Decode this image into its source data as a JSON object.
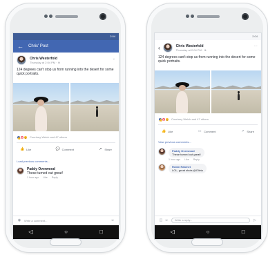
{
  "left_phone": {
    "status_time": "2:04",
    "appbar": {
      "title": "Chris' Post",
      "back_icon": "←"
    },
    "post": {
      "author": "Chris Westerfold",
      "time": "Thursday at 2:04 PM · ⊕",
      "text": "124 degrees can't stop us from running into the desert for some quick portraits.",
      "reactions_text": "Courtney Welch and 47 others",
      "actions": {
        "like": "Like",
        "comment": "Comment",
        "share": "Share"
      },
      "load_previous": "Load previous comments...",
      "comment": {
        "name": "Paddy Overwood",
        "text": "These turned out great!",
        "meta": {
          "time": "1 hour ago",
          "like": "Like",
          "reply": "Reply"
        }
      },
      "composer_placeholder": "Write a comment..."
    }
  },
  "right_phone": {
    "status_time": "2:04",
    "post": {
      "author": "Chris Westerfold",
      "time": "Thursday at 2:04 PM · ⊕",
      "text": "124 degrees can't stop us from running into the desert for some quick portraits.",
      "reactions_text": "Courtney Welch and 47 others",
      "actions": {
        "like": "Like",
        "comment": "Comment",
        "share": "Share"
      },
      "load_previous": "View previous comments...",
      "comments": [
        {
          "name": "Paddy Overwood",
          "text": "These turned out great!",
          "meta": {
            "time": "1 hour ago",
            "like": "Like",
            "reply": "Reply"
          }
        },
        {
          "name": "Robin Ratchet",
          "text": "LOL, great shots @Olivia"
        }
      ],
      "composer_placeholder": "Write a reply..."
    }
  },
  "nav_icons": {
    "back": "◁",
    "home": "○",
    "recent": "□"
  },
  "colors": {
    "facebook_blue": "#4267b2",
    "reaction_like": "#4267b2",
    "reaction_love": "#f25268",
    "reaction_wow": "#f7b928"
  }
}
